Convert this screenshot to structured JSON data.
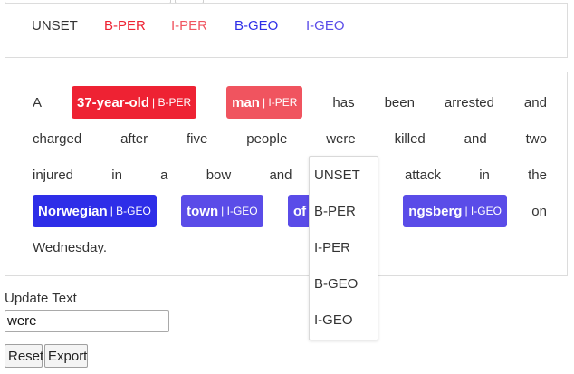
{
  "colors": {
    "b_per": "#ee2233",
    "i_per": "#f0545f",
    "b_geo": "#2e2ee8",
    "i_geo": "#5a4ce8"
  },
  "legend": [
    {
      "label": "UNSET",
      "color": "#333333"
    },
    {
      "label": "B-PER",
      "color": "#ee2233"
    },
    {
      "label": "I-PER",
      "color": "#f0545f"
    },
    {
      "label": "B-GEO",
      "color": "#2e2ee8"
    },
    {
      "label": "I-GEO",
      "color": "#5a4ce8"
    }
  ],
  "tokens": {
    "w_a": "A",
    "t_37": {
      "text": "37-year-old",
      "tag": "| B-PER"
    },
    "t_man": {
      "text": "man",
      "tag": "| I-PER"
    },
    "w_has": "has",
    "w_been": "been",
    "w_arrested": "arrested",
    "w_and1": "and",
    "w_charged": "charged",
    "w_after": "after",
    "w_five": "five",
    "w_people": "people",
    "w_were": "were",
    "w_killed": "killed",
    "w_and2": "and",
    "w_two": "two",
    "w_injured": "injured",
    "w_in1": "in",
    "w_a2": "a",
    "w_bow": "bow",
    "w_and3": "and",
    "w_attack": "attack",
    "w_in2": "in",
    "w_the": "the",
    "t_norwegian": {
      "text": "Norwegian",
      "tag": "| B-GEO"
    },
    "t_town": {
      "text": "town",
      "tag": "| I-GEO"
    },
    "t_of": {
      "text": "of",
      "tag": "| I"
    },
    "t_kongsberg": {
      "text": "ngsberg",
      "tag": "| I-GEO"
    },
    "w_on": "on",
    "w_wednesday": "Wednesday."
  },
  "dropdown": {
    "options": [
      "UNSET",
      "B-PER",
      "I-PER",
      "B-GEO",
      "I-GEO"
    ]
  },
  "update": {
    "label": "Update Text",
    "value": "were"
  },
  "buttons": {
    "reset": "Reset",
    "export": "Export"
  }
}
